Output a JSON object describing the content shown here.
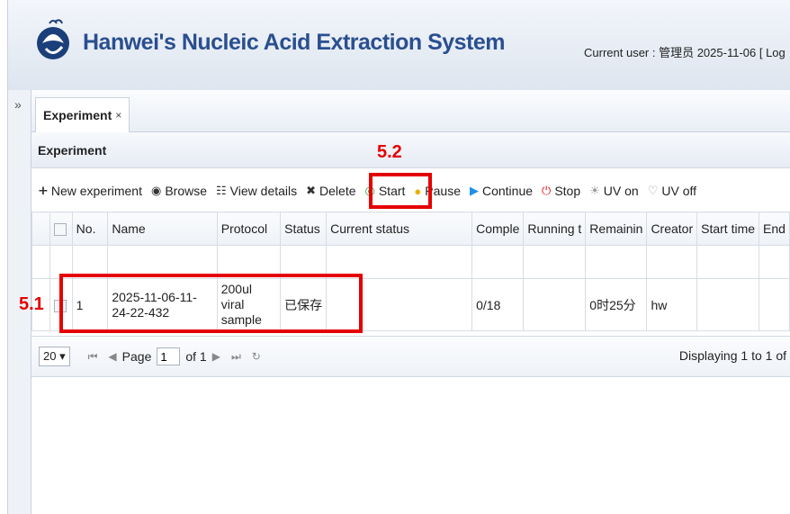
{
  "header": {
    "app_title": "Hanwei's Nucleic Acid Extraction System",
    "user_info": "Current user : 管理员  2025-11-06 [ Log",
    "logo": "app-logo"
  },
  "sidebar": {
    "expand_icon": "»"
  },
  "tabs": [
    {
      "label": "Experiment",
      "close": "×"
    }
  ],
  "panel": {
    "title": "Experiment"
  },
  "toolbar": {
    "new_experiment": "New experiment",
    "browse": "Browse",
    "view_details": "View details",
    "delete": "Delete",
    "start": "Start",
    "pause": "Pause",
    "continue": "Continue",
    "stop": "Stop",
    "uv_on": "UV on",
    "uv_off": "UV off"
  },
  "table": {
    "columns": [
      "No.",
      "Name",
      "Protocol",
      "Status",
      "Current status",
      "Comple",
      "Running t",
      "Remainin",
      "Creator",
      "Start time",
      "End"
    ],
    "rows": [
      {
        "no": "1",
        "name": "2025-11-06-11-24-22-432",
        "protocol": "200ul viral sample",
        "status": "已保存",
        "current_status": "",
        "complete": "0/18",
        "running": "",
        "remaining": "0时25分",
        "creator": "hw",
        "start_time": "",
        "end": ""
      }
    ]
  },
  "pager": {
    "page_size": "20 ▾",
    "page_label": "Page",
    "page_value": "1",
    "of_label": "of 1",
    "display": "Displaying 1 to 1 of"
  },
  "annotations": {
    "row_label": "5.1",
    "start_label": "5.2"
  },
  "colors": {
    "accent": "#2a4f8f",
    "highlight": "#e50000"
  }
}
